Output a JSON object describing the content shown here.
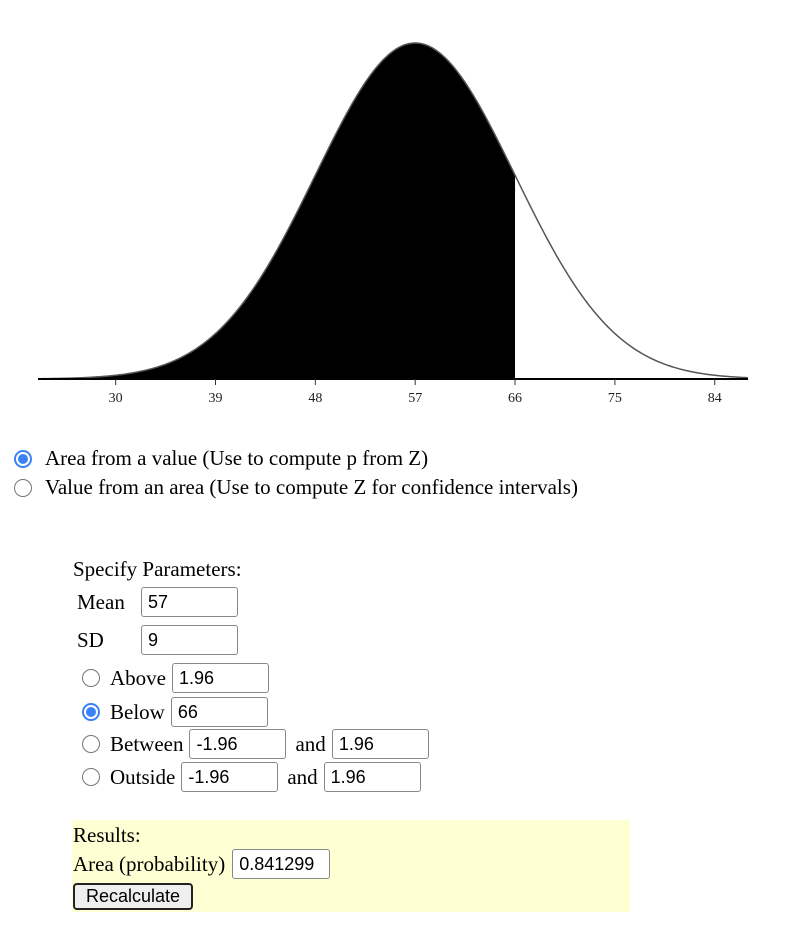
{
  "chart_data": {
    "type": "area",
    "title": "",
    "distribution": "normal",
    "mean": 57,
    "sd": 9,
    "shaded_region": "below",
    "shaded_bound": 66,
    "x_range": [
      23,
      87
    ],
    "x_ticks": [
      30,
      39,
      48,
      57,
      66,
      75,
      84
    ],
    "xlabel": "",
    "ylabel": "",
    "grid": false,
    "colors": {
      "shaded": "#000000",
      "curve": "#555555",
      "axis": "#000000"
    }
  },
  "mode": {
    "options": [
      {
        "label": "Area from a value (Use to compute p from Z)",
        "checked": true
      },
      {
        "label": "Value from an area (Use to compute Z for confidence intervals)",
        "checked": false
      }
    ]
  },
  "params": {
    "title": "Specify Parameters:",
    "mean_label": "Mean",
    "mean_value": "57",
    "sd_label": "SD",
    "sd_value": "9",
    "above_label": "Above",
    "above_value": "1.96",
    "below_label": "Below",
    "below_value": "66",
    "between_label": "Between",
    "between_low": "-1.96",
    "between_and": "and",
    "between_high": "1.96",
    "outside_label": "Outside",
    "outside_low": "-1.96",
    "outside_and": "and",
    "outside_high": "1.96",
    "selected": "below"
  },
  "results": {
    "title": "Results:",
    "area_label": "Area (probability)",
    "area_value": "0.841299",
    "recalc_label": "Recalculate"
  },
  "accent_color": "#3b82f6"
}
